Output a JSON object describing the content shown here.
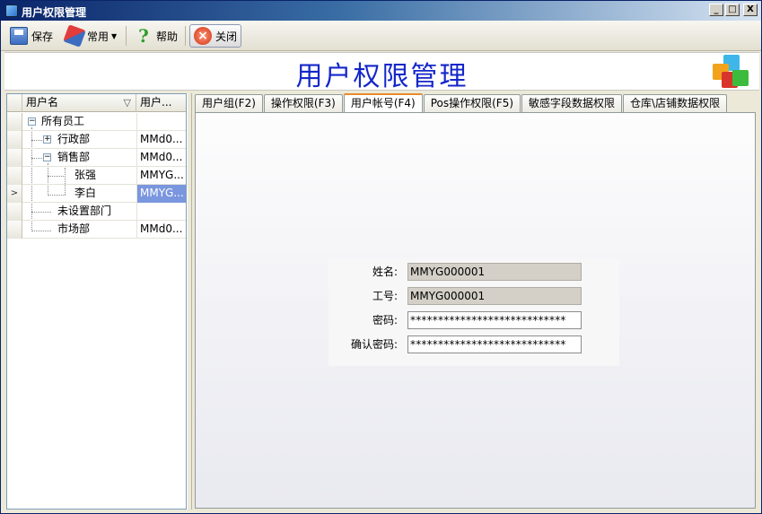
{
  "window": {
    "title": "用户权限管理",
    "buttons": [
      "_",
      "□",
      "X"
    ]
  },
  "toolbar": {
    "save_label": "保存",
    "common_label": "常用",
    "help_label": "帮助",
    "close_label": "关闭"
  },
  "banner": {
    "title": "用户权限管理"
  },
  "user_grid": {
    "columns": [
      "用户名",
      "用户..."
    ],
    "filter_icon": "▽",
    "rows": [
      {
        "name": "所有员工",
        "id": ""
      },
      {
        "name": "行政部",
        "id": "MMd0..."
      },
      {
        "name": "销售部",
        "id": "MMd0..."
      },
      {
        "name": "张强",
        "id": "MMYG..."
      },
      {
        "name": "李白",
        "id": "MMYG..."
      },
      {
        "name": "未设置部门",
        "id": ""
      },
      {
        "name": "市场部",
        "id": "MMd0..."
      }
    ],
    "current_row_marker": ">"
  },
  "tabs": [
    "用户组(F2)",
    "操作权限(F3)",
    "用户帐号(F4)",
    "Pos操作权限(F5)",
    "敏感字段数据权限",
    "仓库\\店铺数据权限"
  ],
  "active_tab": "用户帐号(F4)",
  "account_form": {
    "name_label": "姓名:",
    "name_value": "MMYG000001",
    "code_label": "工号:",
    "code_value": "MMYG000001",
    "password_label": "密码:",
    "password_value": "****************************",
    "confirm_label": "确认密码:",
    "confirm_value": "****************************"
  },
  "colors": {
    "banner_title": "#1427c9",
    "title_bar": "#0a246a",
    "selection": "#7a96df",
    "active_tab_accent": "#e68b2c"
  }
}
